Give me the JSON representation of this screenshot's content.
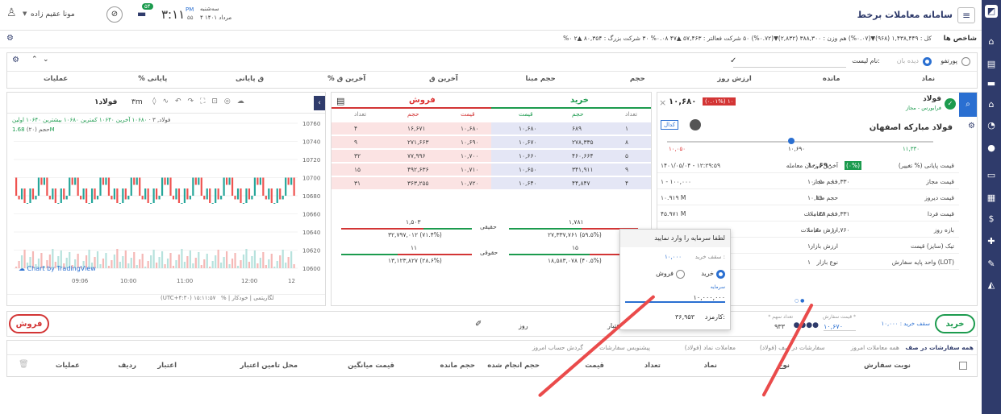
{
  "app": {
    "title": "سامانه معاملات برخط"
  },
  "user": {
    "name": "مونا عقیم زاده",
    "time": "۳:۱۱",
    "ampm": "PM",
    "secs": "۵۵",
    "day": "سه‌شنبه",
    "date": "۴ مرداد ۱۴۰۱",
    "badge": "۵۴"
  },
  "index_bar": {
    "label": "شاخص ها",
    "text": "کل : ۱,۴۳۸,۴۴۹ (۹۶۸)▼(۰.۰۷%)  هم وزن : ۳۸۸,۳۰۰ (۲,۸۳۲)▼(۰.۷۲%)  ۵۰ شرکت فعالتر : ۵۷,۴۶۳ ▲۴۷ ۰.۰۸%  ۳۰ شرکت بزرگ : ۸۰,۳۵۴ ▲۲ ۰%"
  },
  "watch": {
    "portfolio": "پورتفو",
    "market": "دیده بان",
    "list_label": "نام لیست:"
  },
  "watch_cols": [
    "نماد",
    "مانده",
    "ارزش روز",
    "حجم",
    "حجم مبنا",
    "آخرین ق",
    "% آخرین ق",
    "ق پایانی",
    "% پایانی",
    "عملیات"
  ],
  "symbol": {
    "short": "فولاد",
    "market": "فرابورس - مجاز",
    "full": "فولاد مبارکه اصفهان",
    "last_badge": "۱۰,۶۸۰",
    "change_badge": "(۰.۰۱%) ۱۰",
    "code_badge": "کدال",
    "low": "۱۰,۰۵۰",
    "mid": "۱۰,۶۹۰",
    "high": "۱۱,۳۳۰"
  },
  "symbol_info": [
    {
      "l": "قیمت پایانی (% تغییر)",
      "v": "۱۰,۶۹۰",
      "v2": "(۰%)",
      "l2": "آخرین / زمان معامله",
      "v3": "۱۴۰۱/۰۵/۰۴ - ۱۲:۲۹:۵۹"
    },
    {
      "l": "قیمت مجاز",
      "v": "۱۰,۰۵۰ - ۱۱,۳۳۰",
      "l2": "حجم مجاز",
      "v3": "۱ - ۱۰۰,۰۰۰"
    },
    {
      "l": "قیمت دیروز",
      "v": "۱۰,۶۹۰",
      "l2": "حجم مبنا",
      "v3": "۱۰.۹۱۹ M"
    },
    {
      "l": "قیمت فردا",
      "v": "۱۰,۰۴۹ - ۱۱,۳۳۱",
      "l2": "حجم معاملات",
      "v3": "۴۵.۹۷۱ M"
    },
    {
      "l": "بازه روز",
      "v": "۱۰,۶۰۰ - ۱۰,۷۶۰",
      "l2": "ارزش معاملات",
      "v3": ""
    },
    {
      "l": "تیک (سایز) قیمت",
      "v": "۱۰",
      "l2": "ارزش بازار",
      "v3": ""
    },
    {
      "l": "واحد پایه سفارش (LOT)",
      "v": "۱",
      "l2": "نوع بازار",
      "v3": ""
    }
  ],
  "orderbook": {
    "buy_title": "خرید",
    "sell_title": "فروش",
    "cols": [
      "تعداد",
      "حجم",
      "قیمت",
      "قیمت",
      "حجم",
      "تعداد"
    ],
    "rows": [
      {
        "bc": "۱",
        "bv": "۶۸۹",
        "bp": "۱۰,۶۸۰",
        "sp": "۱۰,۶۸۰",
        "sv": "۱۶,۶۷۱",
        "sc": "۴"
      },
      {
        "bc": "۸",
        "bv": "۲۷۸,۳۳۵",
        "bp": "۱۰,۶۷۰",
        "sp": "۱۰,۶۹۰",
        "sv": "۲۷۱,۶۶۳",
        "sc": "۹"
      },
      {
        "bc": "۵",
        "bv": "۴۶۰,۶۶۴",
        "bp": "۱۰,۶۶۰",
        "sp": "۱۰,۷۰۰",
        "sv": "۷۷,۹۹۶",
        "sc": "۳۲"
      },
      {
        "bc": "۹",
        "bv": "۳۴۱,۹۱۱",
        "bp": "۱۰,۶۵۰",
        "sp": "۱۰,۷۱۰",
        "sv": "۴۹۲,۶۳۶",
        "sc": "۱۵"
      },
      {
        "bc": "۴",
        "bv": "۴۴,۸۴۷",
        "bp": "۱۰,۶۴۰",
        "sp": "۱۰,۷۲۰",
        "sv": "۳۶۳,۲۵۵",
        "sc": "۳۱"
      }
    ],
    "real_label": "حقیقی",
    "legal_label": "حقوقی",
    "real_buy_count": "۱,۷۸۱",
    "real_sell_count": "۱,۵۰۳",
    "real_buy_vol": "۲۷,۳۳۷,۷۶۱ (۵۹.۵%)",
    "real_sell_vol": "۳۲,۷۹۷,۰۱۲ (۷۱.۴%)",
    "legal_buy_count": "۱۵",
    "legal_sell_count": "۱۱",
    "legal_buy_vol": "۱۸,۵۸۳,۰۷۸ (۴۰.۵%)",
    "legal_sell_vol": "۱۳,۱۲۳,۸۲۷ (۲۸.۶%)"
  },
  "chart_widget": {
    "symbol": "فولاد۱",
    "legend1": "فولاد, ۳ ·",
    "legend2": "۱۰۶۸۰ آخرین ۱۰۶۴۰ کمترین ۱۰۶۸۰ بیشترین ۱۰۶۴۰ اولین",
    "vol_label": "حجم (۲۰)",
    "vol_val": "1.68M",
    "watermark": "Chart by TradingView",
    "tabs": "%  |  لگاریتمی  |  خودکار",
    "tz": "(UTC+۴:۳۰) ۱۵:۱۱:۵۷",
    "prices": [
      "10760",
      "10740",
      "10720",
      "10700",
      "10680",
      "10660",
      "10640",
      "10620",
      "10600"
    ],
    "times": [
      "09:06",
      "10:00",
      "11:00",
      "12:00",
      "12"
    ],
    "tf": "۳m"
  },
  "popup": {
    "title": "لطفا سرمایه را وارد نمایید",
    "ceiling_label": "سقف خرید :",
    "ceiling_val": "۱۰,۰۰۰",
    "buy_label": "خرید",
    "sell_label": "فروش",
    "capital_label": "سرمایه",
    "capital_val": "۱۰,۰۰۰,۰۰۰",
    "fee_label": "کارمزد:",
    "fee_val": "۳۶,۹۵۳"
  },
  "order": {
    "buy_btn": "خرید",
    "sell_btn": "فروش",
    "ceiling_text": "سقف خرید : ۱۰,۰۰۰",
    "price_label": "قیمت سفارش *",
    "price_val": "۱۰,۶۷۰",
    "qty_label": "* تعداد سهم",
    "qty_val": "۹۳۳",
    "day_label": "روز",
    "credit_label": "مالی و اعتبار"
  },
  "bottom_tabs": [
    "همه سفارشات در صف",
    "همه معاملات امروز",
    "سفارشات در صف (فولاد)",
    "معاملات نماد (فولاد)",
    "پیشنویس سفارشات",
    "گردش حساب امروز"
  ],
  "bottom_cols": [
    "نوبت سفارش",
    "نوع",
    "نماد",
    "تعداد",
    "قیمت",
    "حجم انجام شده",
    "حجم مانده",
    "قیمت میانگین",
    "محل تامین اعتبار",
    "اعتبار",
    "ردیف",
    "عملیات"
  ],
  "colors": {
    "navy": "#2f3b6b",
    "buy": "#1c9b4e",
    "sell": "#d33535",
    "accent": "#2a6fd1"
  }
}
